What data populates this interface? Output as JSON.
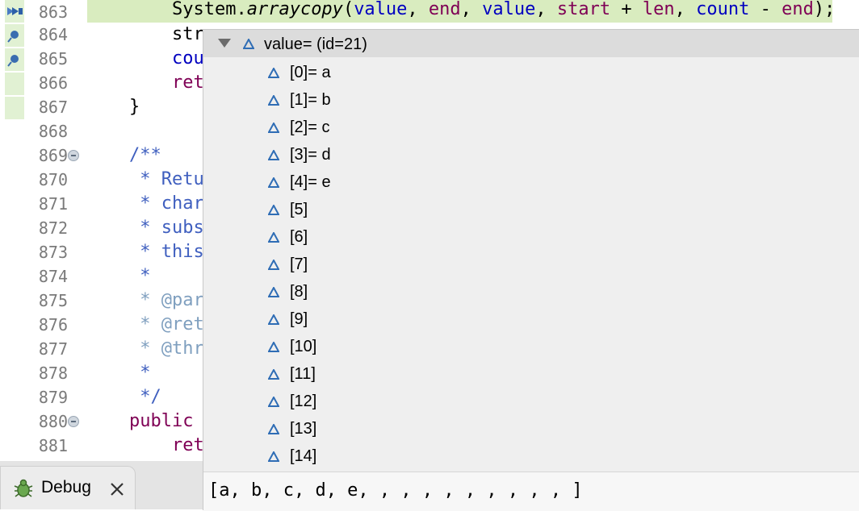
{
  "editor": {
    "lines": [
      {
        "num": "863",
        "code": "System.arraycopy(value, end, value, start + len, count - end);",
        "marker": "current-instruction",
        "current": true
      },
      {
        "num": "864",
        "code": "str",
        "marker": "step-marker"
      },
      {
        "num": "865",
        "code": "cou",
        "marker": "step-marker"
      },
      {
        "num": "866",
        "code": "ret",
        "marker": "gutter-mark"
      },
      {
        "num": "867",
        "code": "}",
        "marker": "gutter-mark"
      },
      {
        "num": "868",
        "code": ""
      },
      {
        "num": "869",
        "code": "/**",
        "fold": true
      },
      {
        "num": "870",
        "code": " * Retu"
      },
      {
        "num": "871",
        "code": " * char"
      },
      {
        "num": "872",
        "code": " * subs"
      },
      {
        "num": "873",
        "code": " * this"
      },
      {
        "num": "874",
        "code": " *"
      },
      {
        "num": "875",
        "code": " * @par"
      },
      {
        "num": "876",
        "code": " * @ret"
      },
      {
        "num": "877",
        "code": " * @thr"
      },
      {
        "num": "878",
        "code": " *"
      },
      {
        "num": "879",
        "code": " */"
      },
      {
        "num": "880",
        "code": "public",
        "fold": true
      },
      {
        "num": "881",
        "code": "ret"
      }
    ],
    "line863_parts": [
      "System.",
      "arraycopy",
      "(",
      "value",
      ", ",
      "end",
      ", ",
      "value",
      ", ",
      "start",
      " + ",
      "len",
      ", ",
      "count",
      " - ",
      "end",
      ");"
    ]
  },
  "inspect": {
    "root_label": "value= (id=21)",
    "children": [
      "[0]= a",
      "[1]= b",
      "[2]= c",
      "[3]= d",
      "[4]= e",
      "[5]",
      "[6]",
      "[7]",
      "[8]",
      "[9]",
      "[10]",
      "[11]",
      "[12]",
      "[13]",
      "[14]"
    ],
    "detail": "[a, b, c, d, e, , , , , , , , , , ]"
  },
  "debug_tab": {
    "label": "Debug",
    "icon": "bug-icon",
    "close_icon": "close-icon"
  },
  "colors": {
    "keyword": "#7f0055",
    "field": "#0000c0",
    "comment": "#3f5fbf",
    "current_line": "#d9ecbf",
    "variable_icon": "#2f6db5"
  }
}
